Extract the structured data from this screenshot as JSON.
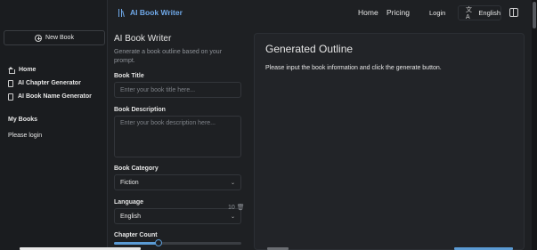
{
  "app": {
    "title": "AI Book Writer"
  },
  "topnav": {
    "home": "Home",
    "pricing": "Pricing",
    "login": "Login",
    "language": "English"
  },
  "sidebar": {
    "new_book": "New Book",
    "items": [
      {
        "label": "Home"
      },
      {
        "label": "AI Chapter Generator"
      },
      {
        "label": "AI Book Name Generator"
      }
    ],
    "my_books": "My Books",
    "please_login": "Please login"
  },
  "form": {
    "title": "AI Book Writer",
    "subtitle": "Generate a book outline based on your prompt.",
    "book_title_label": "Book Title",
    "book_title_placeholder": "Enter your book title here...",
    "book_desc_label": "Book Description",
    "book_desc_placeholder": "Enter your book description here...",
    "category_label": "Book Category",
    "category_value": "Fiction",
    "language_label": "Language",
    "language_value": "English",
    "chapter_count_label": "Chapter Count",
    "chapter_count_value": "10",
    "chapter_slider_fraction": 0.35
  },
  "outline": {
    "title": "Generated Outline",
    "message": "Please input the book information and click the generate button."
  },
  "colors": {
    "accent": "#5b9bd5",
    "logo": "#6fa8e8",
    "background": "#1e2023"
  }
}
